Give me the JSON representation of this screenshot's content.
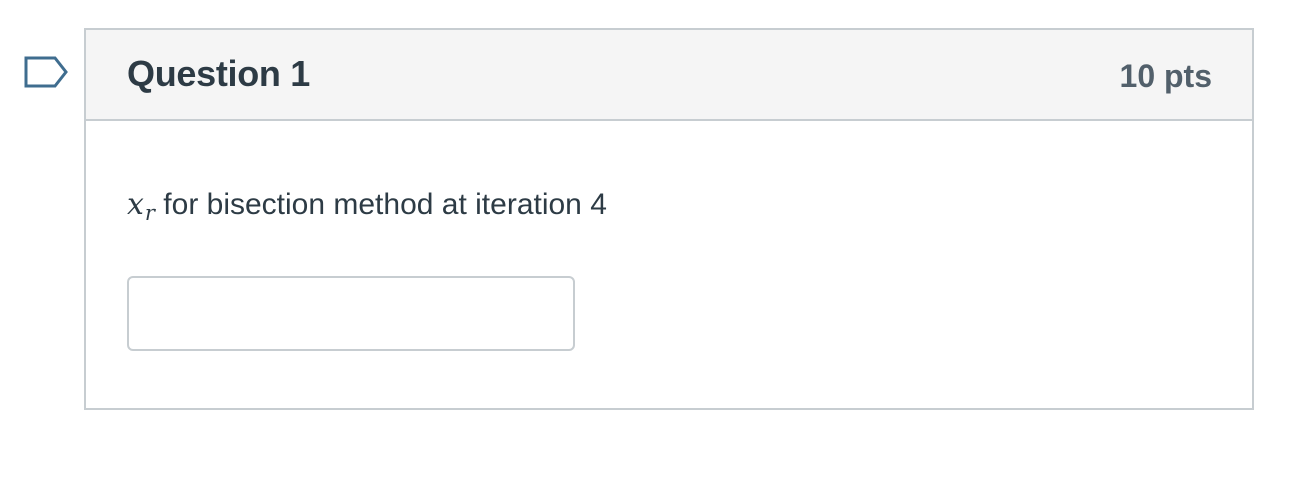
{
  "question": {
    "title": "Question 1",
    "points": "10 pts",
    "text": {
      "variable": "x",
      "subscript": "r",
      "rest": " for bisection method at iteration 4"
    },
    "answer": {
      "value": "",
      "placeholder": ""
    }
  },
  "icons": {
    "flag": "flag-question-icon"
  },
  "colors": {
    "border": "#c7cdd1",
    "header_bg": "#f5f5f5",
    "title": "#2d3b45",
    "points": "#52606b",
    "flag": "#3f6d8f"
  }
}
